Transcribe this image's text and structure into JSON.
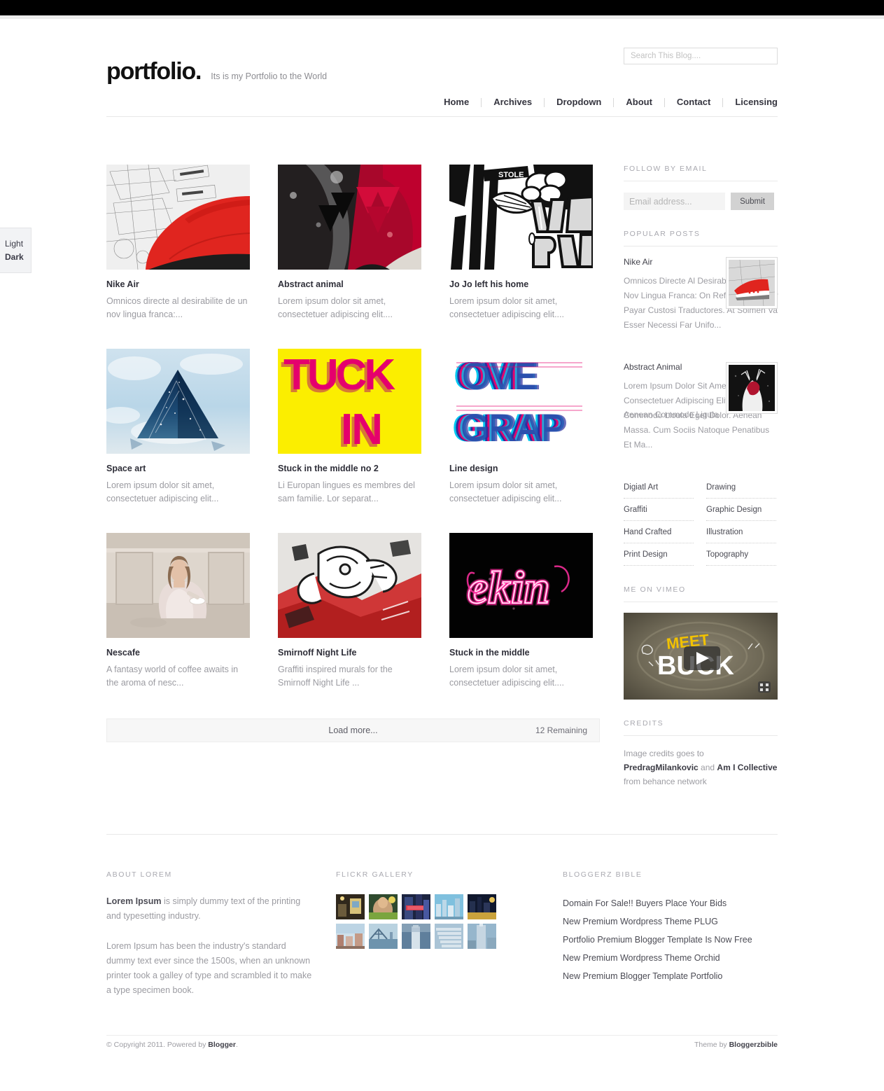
{
  "header": {
    "title": "portfolio.",
    "tagline": "Its is my Portfolio to the World",
    "search_placeholder": "Search This Blog....",
    "nav": [
      {
        "label": "Home"
      },
      {
        "label": "Archives"
      },
      {
        "label": "Dropdown"
      },
      {
        "label": "About"
      },
      {
        "label": "Contact"
      },
      {
        "label": "Licensing"
      }
    ]
  },
  "theme_switch": {
    "light": "Light",
    "dark": "Dark"
  },
  "posts": [
    {
      "title": "Nike Air",
      "excerpt": "Omnicos directe al desirabilite de un nov lingua franca:...",
      "art": "shoe"
    },
    {
      "title": "Abstract animal",
      "excerpt": "Lorem ipsum dolor sit amet, consectetuer adipiscing elit....",
      "art": "triangles"
    },
    {
      "title": "Jo Jo left his home",
      "excerpt": "Lorem ipsum dolor sit amet, consectetuer adipiscing elit....",
      "art": "graffiti-bw"
    },
    {
      "title": "Space art",
      "excerpt": "Lorem ipsum dolor sit amet, consectetuer adipiscing elit...",
      "art": "space"
    },
    {
      "title": "Stuck in the middle no 2",
      "excerpt": "Li Europan lingues es membres del sam familie. Lor separat...",
      "art": "tuckin"
    },
    {
      "title": "Line design",
      "excerpt": "Lorem ipsum dolor sit amet, consectetuer adipiscing elit...",
      "art": "lines"
    },
    {
      "title": "Nescafe",
      "excerpt": "A fantasy world of coffee awaits in the aroma of nesc...",
      "art": "woman"
    },
    {
      "title": "Smirnoff Night Life",
      "excerpt": "Graffiti inspired murals for the Smirnoff Night Life ...",
      "art": "mural"
    },
    {
      "title": "Stuck in the middle",
      "excerpt": "Lorem ipsum dolor sit amet, consectetuer adipiscing elit....",
      "art": "neon"
    }
  ],
  "load_more": {
    "label": "Load more...",
    "remaining": "12 Remaining"
  },
  "sidebar": {
    "follow": {
      "title": "FOLLOW BY EMAIL",
      "placeholder": "Email address...",
      "submit": "Submit"
    },
    "popular": {
      "title": "POPULAR POSTS",
      "items": [
        {
          "title": "Nike Air",
          "text": "Omnicos Directe Al Desirabilite De Un Nov Lingua Franca: On Refusa Continuar Payar Custosi Traductores. At Solmen Va Esser Necessi Far Unifo..."
        },
        {
          "title": "Abstract Animal",
          "text": "Lorem Ipsum Dolor Sit Amet, Consectetuer Adipiscing Elit. Aenean Commodo Lioula Eget Dolor. Aenean Massa. Cum Sociis Natoque Penatibus Et Ma...",
          "overlap_text": "Aenean Commodo Ligula"
        }
      ]
    },
    "categories": [
      "Digiatl Art",
      "Drawing",
      "Graffiti",
      "Graphic Design",
      "Hand Crafted",
      "Illustration",
      "Print Design",
      "Topography"
    ],
    "vimeo": {
      "title": "ME ON VIMEO",
      "video_text": "MEET BUCK"
    },
    "credits": {
      "title": "CREDITS",
      "prefix": "Image credits goes to ",
      "name1": "PredragMilankovic",
      "middle": " and ",
      "name2": "Am I Collective",
      "suffix": " from behance network"
    }
  },
  "footer": {
    "about": {
      "title": "ABOUT LOREM",
      "p1_bold": "Lorem Ipsum",
      "p1_rest": " is simply dummy text of the printing and typesetting industry.",
      "p2": "Lorem Ipsum has been the industry's standard dummy text ever since the 1500s, when an unknown printer took a galley of type and scrambled it to make a type specimen book."
    },
    "flickr": {
      "title": "FLICKR GALLERY",
      "count": 10
    },
    "bible": {
      "title": "BLOGGERZ BIBLE",
      "links": [
        "Domain For Sale!! Buyers Place Your Bids",
        "New Premium Wordpress Theme PLUG",
        "Portfolio Premium Blogger Template Is Now Free",
        "New Premium Wordpress Theme Orchid",
        "New Premium Blogger Template Portfolio"
      ]
    },
    "bottom": {
      "copyright_prefix": "© Copyright 2011. Powered by ",
      "copyright_link": "Blogger",
      "copyright_suffix": ".",
      "theme_prefix": "Theme by ",
      "theme_link": "Bloggerzbible"
    }
  },
  "colors": {
    "accent": "#000000",
    "muted": "#9b9ba1",
    "rule": "#e8e8e8"
  }
}
